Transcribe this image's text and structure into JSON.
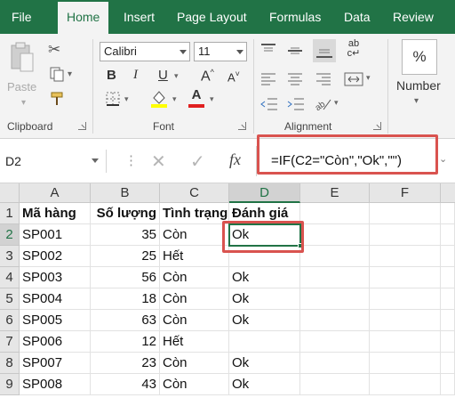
{
  "tabs": [
    "File",
    "Home",
    "Insert",
    "Page Layout",
    "Formulas",
    "Data",
    "Review"
  ],
  "active_tab": "Home",
  "clipboard": {
    "paste_label": "Paste",
    "group_label": "Clipboard"
  },
  "font": {
    "name": "Calibri",
    "size": "11",
    "group_label": "Font",
    "bold": "B",
    "italic": "I",
    "underline": "U",
    "grow": "A",
    "shrink": "A",
    "color_a": "A"
  },
  "alignment": {
    "group_label": "Alignment"
  },
  "number": {
    "label": "Number",
    "percent": "%"
  },
  "formula_bar": {
    "name_box": "D2",
    "fx": "fx",
    "formula": "=IF(C2=\"Còn\",\"Ok\",\"\")"
  },
  "columns": [
    "A",
    "B",
    "C",
    "D",
    "E",
    "F"
  ],
  "rows": [
    {
      "num": "1",
      "a": "Mã hàng",
      "b": "Số lượng",
      "c": "Tình trạng",
      "d": "Đánh giá"
    },
    {
      "num": "2",
      "a": "SP001",
      "b": "35",
      "c": "Còn",
      "d": "Ok"
    },
    {
      "num": "3",
      "a": "SP002",
      "b": "25",
      "c": "Hết",
      "d": ""
    },
    {
      "num": "4",
      "a": "SP003",
      "b": "56",
      "c": "Còn",
      "d": "Ok"
    },
    {
      "num": "5",
      "a": "SP004",
      "b": "18",
      "c": "Còn",
      "d": "Ok"
    },
    {
      "num": "6",
      "a": "SP005",
      "b": "63",
      "c": "Còn",
      "d": "Ok"
    },
    {
      "num": "7",
      "a": "SP006",
      "b": "12",
      "c": "Hết",
      "d": ""
    },
    {
      "num": "8",
      "a": "SP007",
      "b": "23",
      "c": "Còn",
      "d": "Ok"
    },
    {
      "num": "9",
      "a": "SP008",
      "b": "43",
      "c": "Còn",
      "d": "Ok"
    }
  ],
  "colors": {
    "ribbon_green": "#217346",
    "highlight_red": "#d9534f",
    "font_color_red": "#e02020",
    "fill_yellow": "#ffff00"
  }
}
